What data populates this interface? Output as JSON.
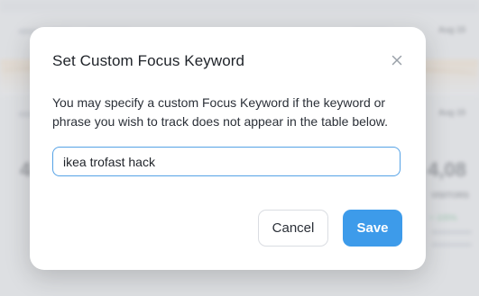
{
  "background": {
    "nav_labels": [
      "Aug 15",
      "Aug 15"
    ],
    "stats": [
      {
        "value": "4",
        "label": ""
      },
      {
        "value": "4,08",
        "label": "VISITORS"
      }
    ],
    "trend": "+ 105%"
  },
  "modal": {
    "title": "Set Custom Focus Keyword",
    "description": "You may specify a custom Focus Keyword if the keyword or phrase you wish to track does not appear in the table below.",
    "input_value": "ikea trofast hack",
    "cancel_label": "Cancel",
    "save_label": "Save",
    "close_icon": "close-icon"
  },
  "colors": {
    "accent": "#3d9bea",
    "input_border": "#55a2e6",
    "overlay": "#e9eaec"
  }
}
